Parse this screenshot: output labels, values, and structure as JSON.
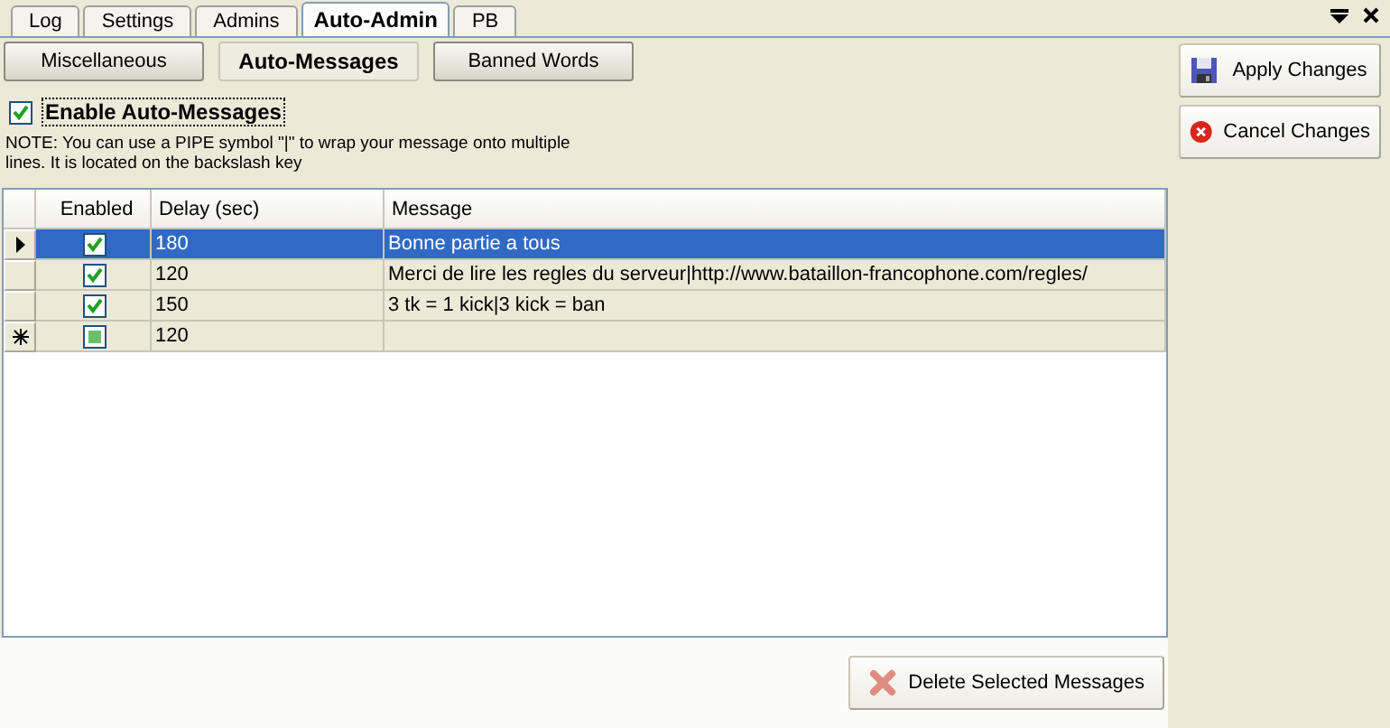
{
  "tabs": [
    {
      "label": "Log",
      "selected": false
    },
    {
      "label": "Settings",
      "selected": false
    },
    {
      "label": "Admins",
      "selected": false
    },
    {
      "label": "Auto-Admin",
      "selected": true
    },
    {
      "label": "PB",
      "selected": false
    }
  ],
  "subtabs": [
    {
      "label": "Miscellaneous",
      "selected": false
    },
    {
      "label": "Auto-Messages",
      "selected": true
    },
    {
      "label": "Banned Words",
      "selected": false
    }
  ],
  "enable": {
    "label": "Enable Auto-Messages",
    "checked": true
  },
  "note": "NOTE: You can use a PIPE symbol \"|\" to wrap your message onto multiple lines. It is located on the backslash key",
  "table": {
    "columns": [
      "Enabled",
      "Delay (sec)",
      "Message"
    ],
    "rows": [
      {
        "kind": "row",
        "selected": true,
        "enabled": true,
        "delay": "180",
        "message": "Bonne partie a tous"
      },
      {
        "kind": "row",
        "selected": false,
        "enabled": true,
        "delay": "120",
        "message": "Merci de lire les regles  du serveur|http://www.bataillon-francophone.com/regles/"
      },
      {
        "kind": "row",
        "selected": false,
        "enabled": true,
        "delay": "150",
        "message": "3 tk = 1 kick|3 kick = ban"
      },
      {
        "kind": "new",
        "selected": false,
        "delay": "120"
      }
    ]
  },
  "buttons": {
    "apply": "Apply Changes",
    "cancel": "Cancel Changes",
    "delete": "Delete Selected Messages"
  }
}
